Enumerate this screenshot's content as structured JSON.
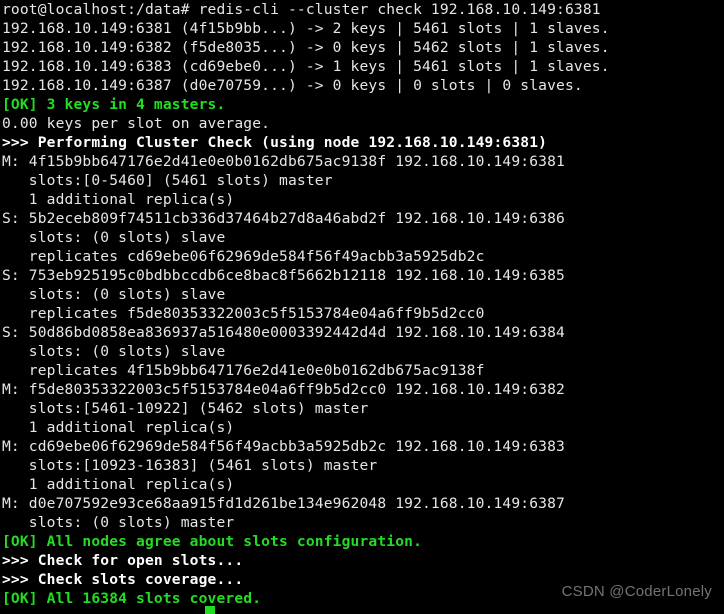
{
  "terminal": {
    "title": "redis-cli --cluster check",
    "background_color": "#000000",
    "colors": {
      "normal_text": "#e6e6e6",
      "bold_white": "#ffffff",
      "success_green": "#22dd22",
      "watermark_gray": "#737373"
    },
    "cursor": {
      "visible": true,
      "color": "#22dd22",
      "column": 23,
      "row": 32
    },
    "lines": [
      {
        "text": "root@localhost:/data# redis-cli --cluster check 192.168.10.149:6381",
        "style": "c-white"
      },
      {
        "text": "192.168.10.149:6381 (4f15b9bb...) -> 2 keys | 5461 slots | 1 slaves.",
        "style": "c-white"
      },
      {
        "text": "192.168.10.149:6382 (f5de8035...) -> 0 keys | 5462 slots | 1 slaves.",
        "style": "c-white"
      },
      {
        "text": "192.168.10.149:6383 (cd69ebe0...) -> 1 keys | 5461 slots | 1 slaves.",
        "style": "c-white"
      },
      {
        "text": "192.168.10.149:6387 (d0e70759...) -> 0 keys | 0 slots | 0 slaves.",
        "style": "c-white"
      },
      {
        "text": "[OK] 3 keys in 4 masters.",
        "style": "c-green"
      },
      {
        "text": "0.00 keys per slot on average.",
        "style": "c-white"
      },
      {
        "text": ">>> Performing Cluster Check (using node 192.168.10.149:6381)",
        "style": "c-bwhite"
      },
      {
        "text": "M: 4f15b9bb647176e2d41e0e0b0162db675ac9138f 192.168.10.149:6381",
        "style": "c-white"
      },
      {
        "text": "   slots:[0-5460] (5461 slots) master",
        "style": "c-white"
      },
      {
        "text": "   1 additional replica(s)",
        "style": "c-white"
      },
      {
        "text": "S: 5b2eceb809f74511cb336d37464b27d8a46abd2f 192.168.10.149:6386",
        "style": "c-white"
      },
      {
        "text": "   slots: (0 slots) slave",
        "style": "c-white"
      },
      {
        "text": "   replicates cd69ebe06f62969de584f56f49acbb3a5925db2c",
        "style": "c-white"
      },
      {
        "text": "S: 753eb925195c0bdbbccdb6ce8bac8f5662b12118 192.168.10.149:6385",
        "style": "c-white"
      },
      {
        "text": "   slots: (0 slots) slave",
        "style": "c-white"
      },
      {
        "text": "   replicates f5de80353322003c5f5153784e04a6ff9b5d2cc0",
        "style": "c-white"
      },
      {
        "text": "S: 50d86bd0858ea836937a516480e0003392442d4d 192.168.10.149:6384",
        "style": "c-white"
      },
      {
        "text": "   slots: (0 slots) slave",
        "style": "c-white"
      },
      {
        "text": "   replicates 4f15b9bb647176e2d41e0e0b0162db675ac9138f",
        "style": "c-white"
      },
      {
        "text": "M: f5de80353322003c5f5153784e04a6ff9b5d2cc0 192.168.10.149:6382",
        "style": "c-white"
      },
      {
        "text": "   slots:[5461-10922] (5462 slots) master",
        "style": "c-white"
      },
      {
        "text": "   1 additional replica(s)",
        "style": "c-white"
      },
      {
        "text": "M: cd69ebe06f62969de584f56f49acbb3a5925db2c 192.168.10.149:6383",
        "style": "c-white"
      },
      {
        "text": "   slots:[10923-16383] (5461 slots) master",
        "style": "c-white"
      },
      {
        "text": "   1 additional replica(s)",
        "style": "c-white"
      },
      {
        "text": "M: d0e707592e93ce68aa915fd1d261be134e962048 192.168.10.149:6387",
        "style": "c-white"
      },
      {
        "text": "   slots: (0 slots) master",
        "style": "c-white"
      },
      {
        "text": "[OK] All nodes agree about slots configuration.",
        "style": "c-green"
      },
      {
        "text": ">>> Check for open slots...",
        "style": "c-bwhite"
      },
      {
        "text": ">>> Check slots coverage...",
        "style": "c-bwhite"
      },
      {
        "text": "[OK] All 16384 slots covered.",
        "style": "c-green"
      }
    ]
  },
  "watermark": {
    "text": "CSDN @CoderLonely"
  }
}
